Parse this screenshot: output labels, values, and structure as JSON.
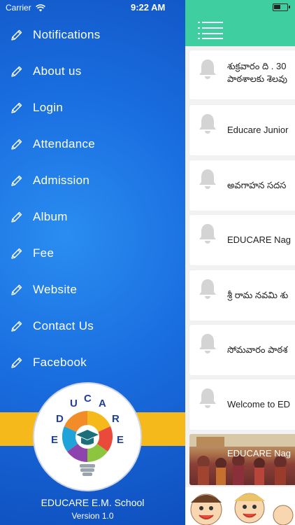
{
  "status_bar": {
    "carrier": "Carrier",
    "time": "9:22 AM"
  },
  "drawer": {
    "menu": [
      {
        "label": "Notifications",
        "icon": "pencil-icon"
      },
      {
        "label": "About us",
        "icon": "pencil-icon"
      },
      {
        "label": "Login",
        "icon": "pencil-icon"
      },
      {
        "label": "Attendance",
        "icon": "pencil-icon"
      },
      {
        "label": "Admission",
        "icon": "pencil-icon"
      },
      {
        "label": "Album",
        "icon": "pencil-icon"
      },
      {
        "label": "Fee",
        "icon": "pencil-icon"
      },
      {
        "label": "Website",
        "icon": "pencil-icon"
      },
      {
        "label": "Contact Us",
        "icon": "pencil-icon"
      },
      {
        "label": "Facebook",
        "icon": "pencil-icon"
      }
    ],
    "logo_letters": [
      "E",
      "D",
      "U",
      "C",
      "A",
      "R",
      "E"
    ],
    "school_name": "EDUCARE E.M. School",
    "version": "Version 1.0"
  },
  "notifications": {
    "items": [
      {
        "title": "శుక్రవారం ది . 30",
        "title2": "పాఠశాలకు శెలవు"
      },
      {
        "title": "Educare Junior"
      },
      {
        "title": "అవగాహన సదస"
      },
      {
        "title": "EDUCARE Nag"
      },
      {
        "title": "శ్రీ రామ నవమి శు"
      },
      {
        "title": "సోమవారం పాఠశ"
      },
      {
        "title": "Welcome to ED"
      }
    ],
    "photo_item": {
      "title": "EDUCARE Nag"
    }
  },
  "colors": {
    "drawer_blue": "#1a6ee0",
    "header_green": "#3fcea0",
    "band_yellow": "#f5b91b"
  }
}
